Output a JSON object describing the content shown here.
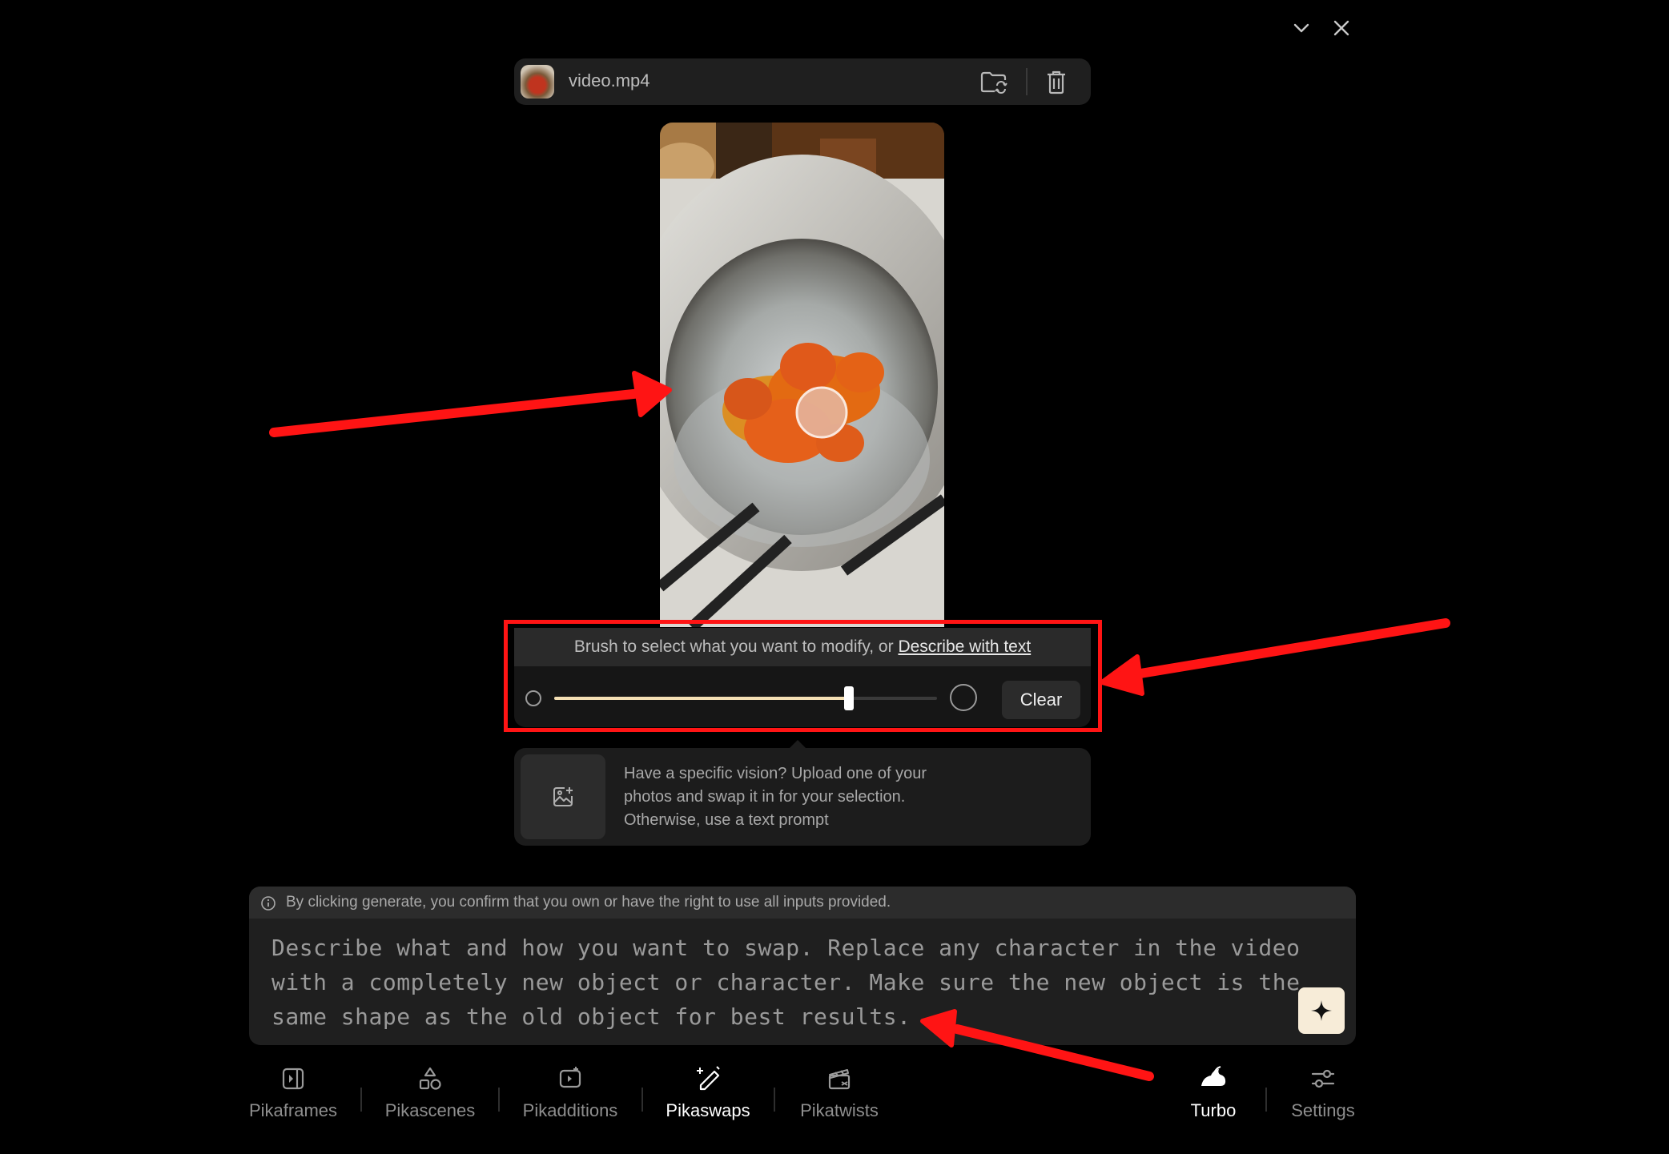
{
  "window": {
    "collapse_icon": "chevron-down-icon",
    "close_icon": "close-icon"
  },
  "file": {
    "name": "video.mp4",
    "replace_icon": "folder-swap-icon",
    "delete_icon": "trash-icon"
  },
  "brush": {
    "instruction": "Brush to select what you want to modify, or ",
    "link_label": "Describe with text",
    "size_level": 0.77,
    "clear_label": "Clear"
  },
  "upload": {
    "icon": "image-add-icon",
    "text": "Have a specific vision? Upload one of your photos and swap it in for your selection. Otherwise, use a text prompt"
  },
  "prompt": {
    "notice": "By clicking generate, you confirm that you own or have the right to use all inputs provided.",
    "placeholder": "Describe what and how you want to swap. Replace any character in the video with a completely new object or character. Make sure the new object is the same shape as the old object for best results.",
    "generate_icon": "sparkle-icon"
  },
  "toolbar": {
    "items": [
      {
        "label": "Pikaframes",
        "icon": "frames-icon"
      },
      {
        "label": "Pikascenes",
        "icon": "shapes-icon"
      },
      {
        "label": "Pikadditions",
        "icon": "add-element-icon"
      },
      {
        "label": "Pikaswaps",
        "icon": "swap-brush-icon",
        "active": true
      },
      {
        "label": "Pikatwists",
        "icon": "clapper-icon"
      }
    ],
    "turbo_label": "Turbo",
    "settings_label": "Settings"
  },
  "colors": {
    "accent": "#f4dfb4",
    "annotation_red": "#ff1414",
    "generate_bg": "#f7ecd8"
  }
}
